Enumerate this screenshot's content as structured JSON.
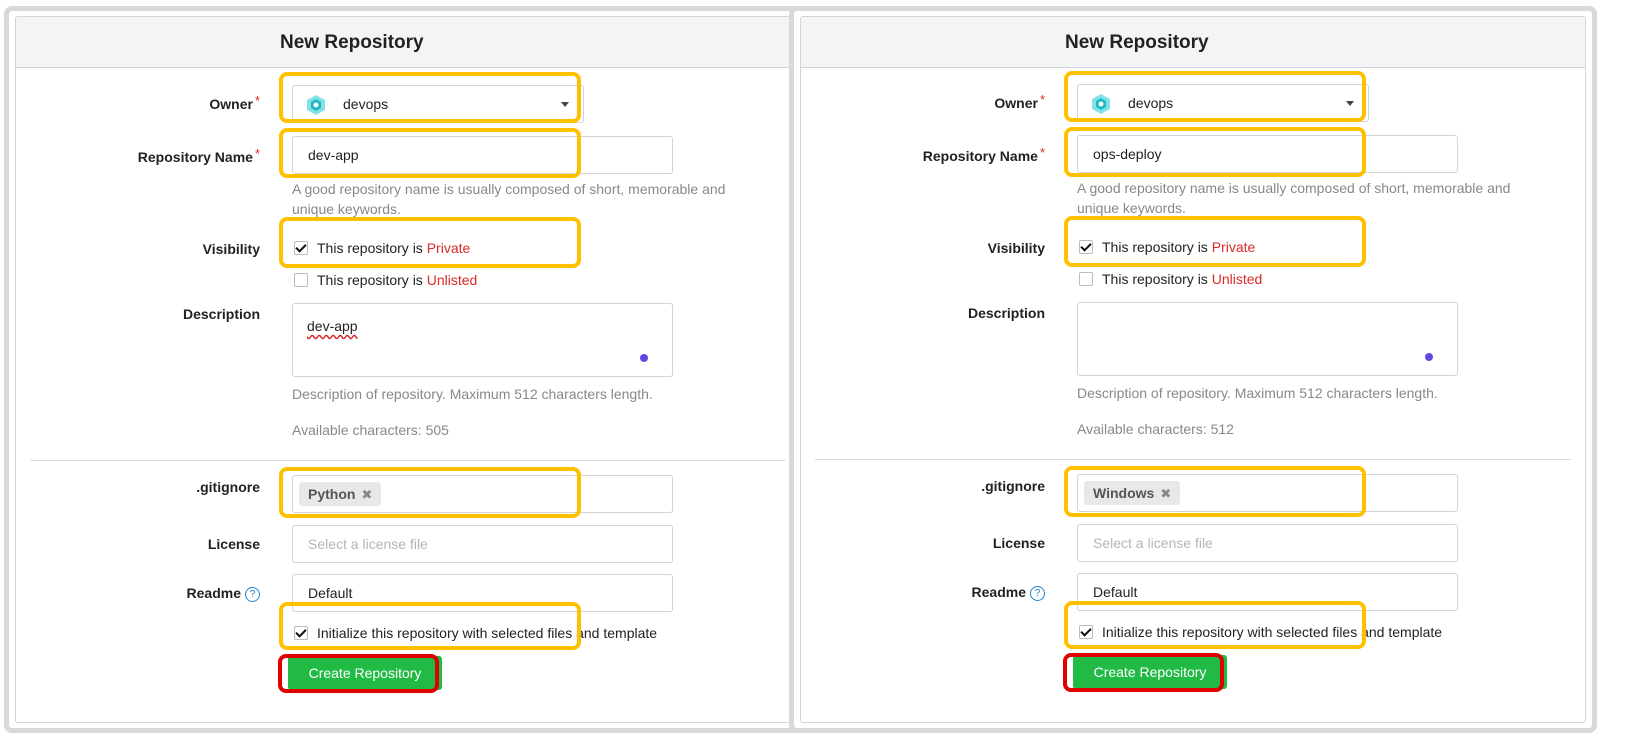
{
  "panels": [
    {
      "title": "New Repository",
      "owner_label": "Owner",
      "owner_value": "devops",
      "repo_name_label": "Repository Name",
      "repo_name_value": "dev-app",
      "repo_name_help": "A good repository name is usually composed of short, memorable and unique keywords.",
      "visibility_label": "Visibility",
      "private_prefix": "This repository is ",
      "private_word": "Private",
      "unlisted_prefix": "This repository is ",
      "unlisted_word": "Unlisted",
      "description_label": "Description",
      "description_value": "dev-app",
      "description_help": "Description of repository. Maximum 512 characters length.",
      "available_chars": "Available characters: 505",
      "gitignore_label": ".gitignore",
      "gitignore_tag": "Python",
      "license_label": "License",
      "license_placeholder": "Select a license file",
      "readme_label": "Readme",
      "readme_value": "Default",
      "init_label": "Initialize this repository with selected files and template",
      "create_button": "Create Repository"
    },
    {
      "title": "New Repository",
      "owner_label": "Owner",
      "owner_value": "devops",
      "repo_name_label": "Repository Name",
      "repo_name_value": "ops-deploy",
      "repo_name_help": "A good repository name is usually composed of short, memorable and unique keywords.",
      "visibility_label": "Visibility",
      "private_prefix": "This repository is ",
      "private_word": "Private",
      "unlisted_prefix": "This repository is ",
      "unlisted_word": "Unlisted",
      "description_label": "Description",
      "description_value": "",
      "description_help": "Description of repository. Maximum 512 characters length.",
      "available_chars": "Available characters: 512",
      "gitignore_label": ".gitignore",
      "gitignore_tag": "Windows",
      "license_label": "License",
      "license_placeholder": "Select a license file",
      "readme_label": "Readme",
      "readme_value": "Default",
      "init_label": "Initialize this repository with selected files and template",
      "create_button": "Create Repository"
    }
  ],
  "colors": {
    "accent_highlight": "#ffc000",
    "button_highlight": "#e00000",
    "button_green": "#21ba45",
    "required_red": "#db2828"
  }
}
